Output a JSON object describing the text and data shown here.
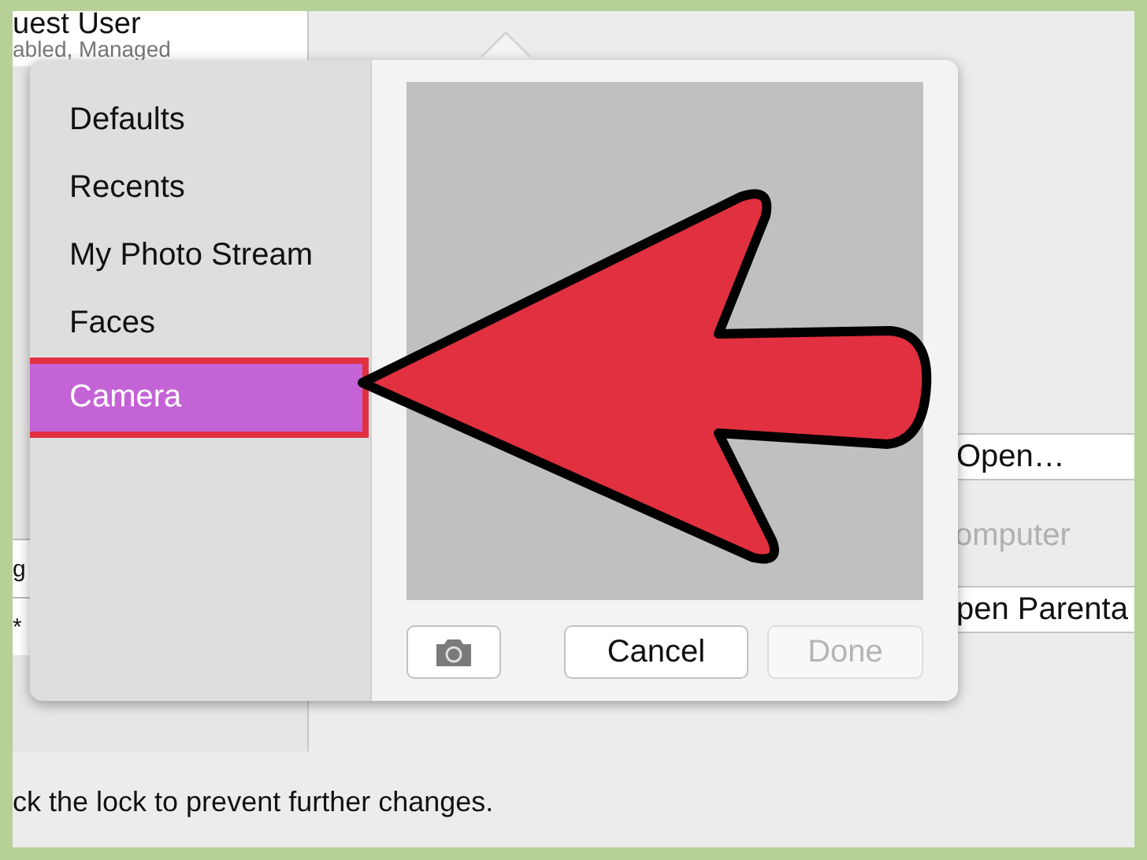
{
  "background": {
    "user_name": "uest User",
    "user_status": "abled, Managed",
    "sidebar_rows": [
      "g",
      "*"
    ],
    "open_button": "Open…",
    "computer_label": "omputer",
    "parental_button": "pen Parenta",
    "lock_text": "ck the lock to prevent further changes."
  },
  "popover": {
    "sources": [
      {
        "label": "Defaults",
        "selected": false,
        "highlighted": false
      },
      {
        "label": "Recents",
        "selected": false,
        "highlighted": false
      },
      {
        "label": "My Photo Stream",
        "selected": false,
        "highlighted": false
      },
      {
        "label": "Faces",
        "selected": false,
        "highlighted": false
      },
      {
        "label": "Camera",
        "selected": true,
        "highlighted": true
      }
    ],
    "buttons": [
      {
        "label": "Cancel",
        "disabled": false
      },
      {
        "label": "Done",
        "disabled": true
      }
    ]
  },
  "annotation": {
    "kind": "arrow"
  }
}
